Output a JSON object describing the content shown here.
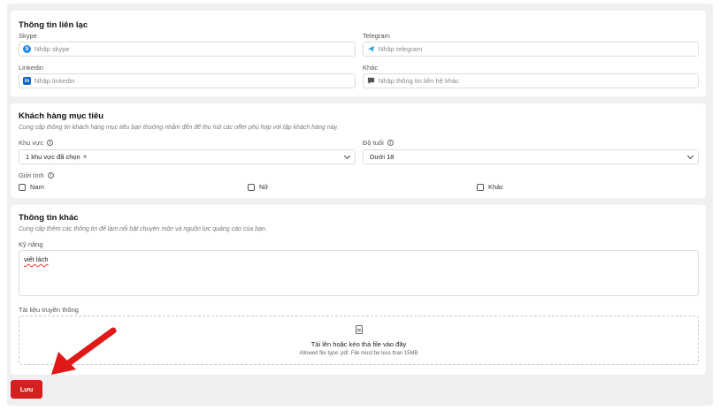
{
  "contact": {
    "title": "Thông tin liên lạc",
    "skype": {
      "label": "Skype",
      "placeholder": "Nhập skype"
    },
    "telegram": {
      "label": "Telegram",
      "placeholder": "Nhập telegram"
    },
    "linkedin": {
      "label": "Linkedin",
      "placeholder": "Nhập linkedin"
    },
    "other": {
      "label": "Khác",
      "placeholder": "Nhập thông tin liên hệ khác"
    }
  },
  "target": {
    "title": "Khách hàng mục tiêu",
    "description": "Cung cấp thông tin khách hàng mục tiêu bạn thường nhắm đến để thu hút các offer phù hợp với tập khách hàng này.",
    "region": {
      "label": "Khu vực",
      "value": "1 khu vực đã chọn"
    },
    "age": {
      "label": "Độ tuổi",
      "value": "Dưới 18"
    },
    "gender": {
      "label": "Giới tính",
      "options": [
        "Nam",
        "Nữ",
        "Khác"
      ]
    }
  },
  "other_info": {
    "title": "Thông tin khác",
    "description": "Cung cấp thêm các thông tin để làm nổi bật chuyên môn và nguồn lực quảng cáo của bạn.",
    "skills": {
      "label": "Kỹ năng",
      "value": "viết lách"
    },
    "media": {
      "label": "Tài liệu truyền thông",
      "upload_title": "Tải lên hoặc kéo thả file vào đây",
      "upload_hint": "Allowed file type: pdf. File must be less than 15MB"
    }
  },
  "actions": {
    "save_label": "Lưu"
  },
  "colors": {
    "primary": "#d42020",
    "background": "#f0f0f2",
    "skype": "#1e88e5",
    "telegram": "#2aa3df",
    "linkedin": "#0a66c2"
  },
  "icons": [
    "skype-icon",
    "telegram-icon",
    "linkedin-icon",
    "message-icon",
    "info-icon",
    "chevron-down-icon",
    "close-icon",
    "file-icon",
    "arrow-annotation"
  ]
}
